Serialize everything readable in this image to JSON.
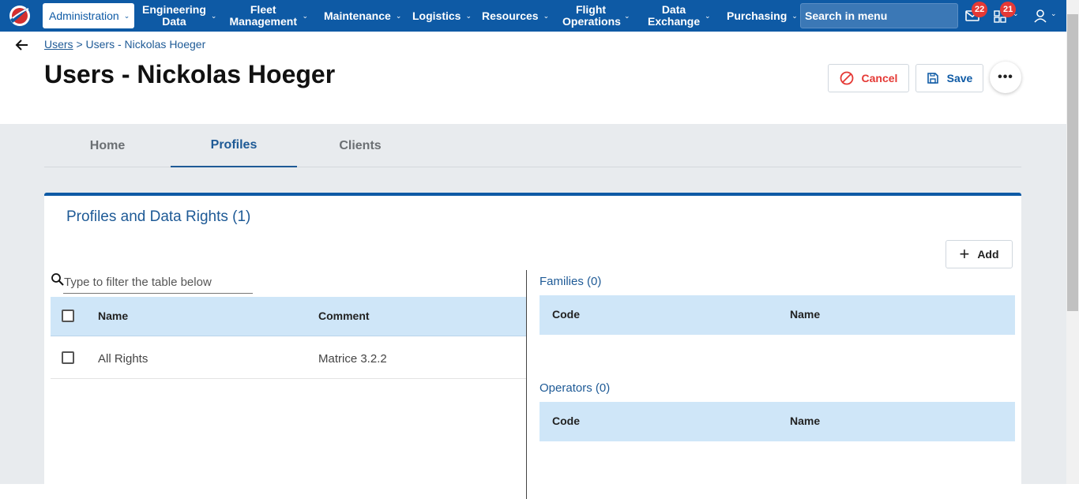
{
  "nav": {
    "items": [
      {
        "label": "Administration",
        "active": true
      },
      {
        "label": "Engineering Data"
      },
      {
        "label": "Fleet Management"
      },
      {
        "label": "Maintenance"
      },
      {
        "label": "Logistics"
      },
      {
        "label": "Resources"
      },
      {
        "label": "Flight Operations"
      },
      {
        "label": "Data Exchange"
      },
      {
        "label": "Purchasing"
      }
    ],
    "search_placeholder": "Search in menu",
    "mail_badge": "22",
    "apps_badge": "21"
  },
  "breadcrumb": {
    "link": "Users",
    "separator": ">",
    "current": "Users - Nickolas Hoeger"
  },
  "page": {
    "title": "Users - Nickolas Hoeger",
    "cancel_label": "Cancel",
    "save_label": "Save"
  },
  "tabs": [
    "Home",
    "Profiles",
    "Clients"
  ],
  "active_tab": "Profiles",
  "card": {
    "title": "Profiles and Data Rights (1)",
    "add_label": "Add",
    "filter_placeholder": "Type to filter the table below",
    "columns": [
      "Name",
      "Comment"
    ],
    "rows": [
      {
        "name": "All Rights",
        "comment": "Matrice 3.2.2"
      }
    ]
  },
  "families": {
    "title": "Families (0)",
    "columns": [
      "Code",
      "Name"
    ]
  },
  "operators": {
    "title": "Operators (0)",
    "columns": [
      "Code",
      "Name"
    ]
  },
  "colors": {
    "nav_bg": "#0e5aa5",
    "accent": "#1e5a96",
    "danger": "#e53935",
    "table_header": "#cfe6f8"
  }
}
